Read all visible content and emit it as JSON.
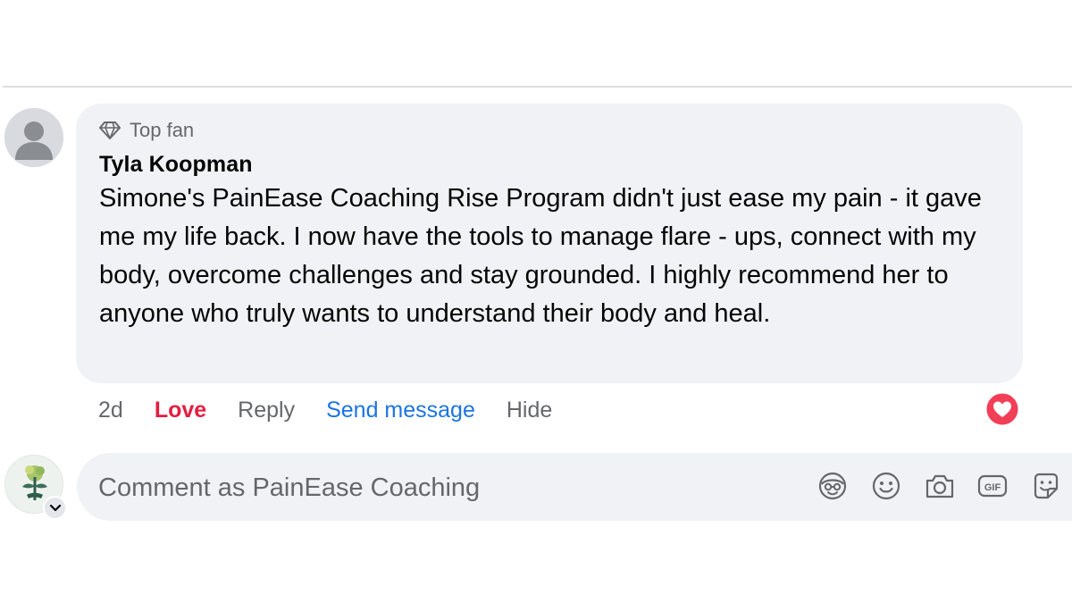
{
  "comment": {
    "badge_label": "Top fan",
    "author": "Tyla Koopman",
    "text": "Simone's PainEase Coaching Rise Program didn't just ease my pain - it gave me my life back. I now have the tools to manage flare - ups, connect with my body, overcome challenges and stay grounded. I highly recommend her to anyone who truly wants to understand their body and heal.",
    "actions": {
      "time": "2d",
      "love": "Love",
      "reply": "Reply",
      "send_message": "Send message",
      "hide": "Hide"
    },
    "reaction": "love-reaction-icon"
  },
  "composer": {
    "placeholder": "Comment as PainEase Coaching",
    "tools": [
      "avatar-sticker-icon",
      "emoji-icon",
      "camera-icon",
      "gif-icon",
      "sticker-icon"
    ]
  },
  "colors": {
    "bubble_bg": "#f0f2f5",
    "love_red": "#e41e3f",
    "link_blue": "#1b74e4",
    "secondary_text": "#65676b"
  }
}
